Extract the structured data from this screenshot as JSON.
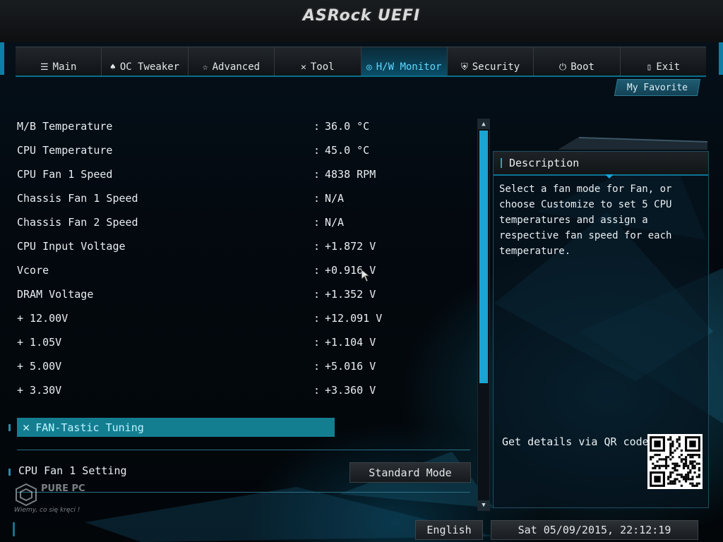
{
  "header": {
    "logo": "ASRock UEFI"
  },
  "tabs": [
    {
      "label": "Main",
      "icon": "list-icon",
      "glyph": "☰",
      "active": false
    },
    {
      "label": "OC Tweaker",
      "icon": "rocket-icon",
      "glyph": "♠",
      "active": false
    },
    {
      "label": "Advanced",
      "icon": "star-icon",
      "glyph": "☆",
      "active": false
    },
    {
      "label": "Tool",
      "icon": "tools-icon",
      "glyph": "✕",
      "active": false
    },
    {
      "label": "H/W Monitor",
      "icon": "monitor-icon",
      "glyph": "◎",
      "active": true
    },
    {
      "label": "Security",
      "icon": "shield-icon",
      "glyph": "⛨",
      "active": false
    },
    {
      "label": "Boot",
      "icon": "power-icon",
      "glyph": "⏻",
      "active": false
    },
    {
      "label": "Exit",
      "icon": "exit-door-icon",
      "glyph": "▯",
      "active": false
    }
  ],
  "favorite": {
    "label": "My Favorite"
  },
  "readings": [
    {
      "label": "M/B Temperature",
      "value": "36.0 °C"
    },
    {
      "label": "CPU Temperature",
      "value": "45.0 °C"
    },
    {
      "label": "CPU Fan 1 Speed",
      "value": "4838 RPM"
    },
    {
      "label": "Chassis Fan 1 Speed",
      "value": "N/A"
    },
    {
      "label": "Chassis Fan 2 Speed",
      "value": "N/A"
    },
    {
      "label": "CPU Input Voltage",
      "value": "+1.872 V"
    },
    {
      "label": "Vcore",
      "value": "+0.916 V"
    },
    {
      "label": "DRAM Voltage",
      "value": "+1.352 V"
    },
    {
      "label": "+ 12.00V",
      "value": "+12.091 V"
    },
    {
      "label": "+ 1.05V",
      "value": "+1.104 V"
    },
    {
      "label": "+ 5.00V",
      "value": "+5.016 V"
    },
    {
      "label": "+ 3.30V",
      "value": "+3.360 V"
    }
  ],
  "separator": ":",
  "fan_tuning": {
    "label": "FAN-Tastic Tuning",
    "icon": "wrench-icon"
  },
  "fan_setting": {
    "label": "CPU Fan 1 Setting",
    "value": "Standard Mode"
  },
  "description": {
    "title": "Description",
    "text": "Select a fan mode for Fan, or choose Customize to set 5 CPU temperatures and assign a respective fan speed for each temperature.",
    "qr_label": "Get details via QR code"
  },
  "watermark": {
    "brand": "PURE PC",
    "slogan": "Wiemy, co się kręci !"
  },
  "footer": {
    "language": "English",
    "datetime": "Sat 05/09/2015, 22:12:19"
  },
  "colors": {
    "accent": "#1aa4d4",
    "highlight_row": "#147e91",
    "active_tab_text": "#5fd8ff"
  }
}
